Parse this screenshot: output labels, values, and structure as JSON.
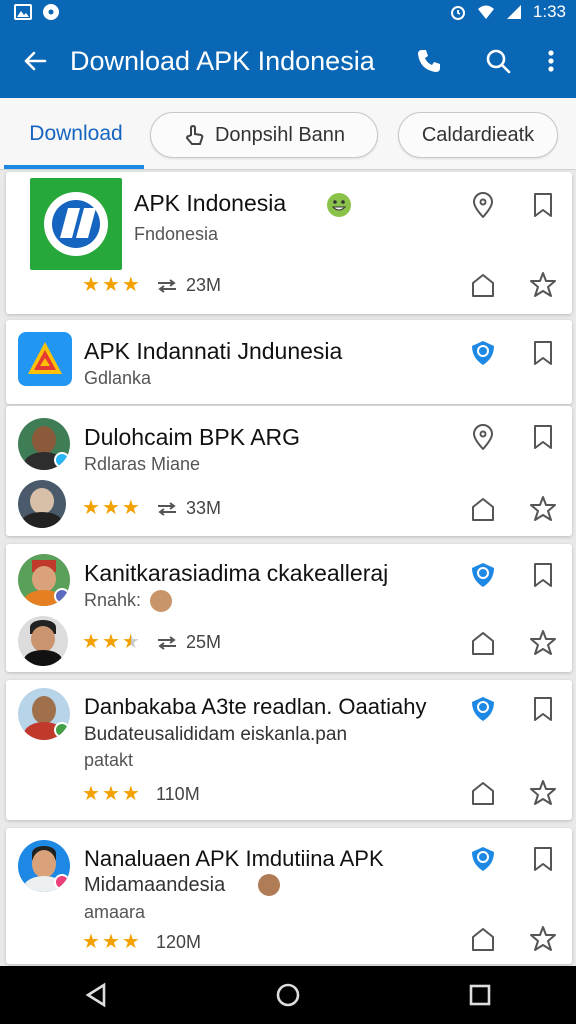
{
  "status_bar": {
    "time": "1:33"
  },
  "app_bar": {
    "title": "Download APK Indonesia"
  },
  "tabs": {
    "active": "Download",
    "chips": [
      "Donpsihl Bann",
      "Caldardieatk"
    ]
  },
  "items": [
    {
      "name": "APK Indonesia",
      "subtitle": "Fndonesia",
      "rating": 3,
      "size": "23M"
    },
    {
      "name": "APK Indannati Jndunesia",
      "subtitle": "Gdlanka"
    },
    {
      "name": "Dulohcaim BPK ARG",
      "subtitle": "Rdlaras Miane",
      "rating": 3,
      "size": "33M"
    },
    {
      "name": "Kanitkarasiadima ckakealleraj",
      "subtitle": "Rnahk:",
      "rating": 2.5,
      "size": "25M"
    },
    {
      "name": "Danbakaba A3te readlan. Oaatiahy",
      "subtitle": "Budateusalididam eiskanla.pan",
      "subtitle2": "patakt",
      "rating": 3,
      "size": "110M"
    },
    {
      "name": "Nanaluaen APK Imdutiina APK",
      "subtitle": "Midamaandesia",
      "subtitle2": "amaara",
      "rating": 3,
      "size": "120M"
    }
  ],
  "colors": {
    "primary": "#0a67b5",
    "accent": "#1e88e5",
    "star": "#f2a100"
  }
}
